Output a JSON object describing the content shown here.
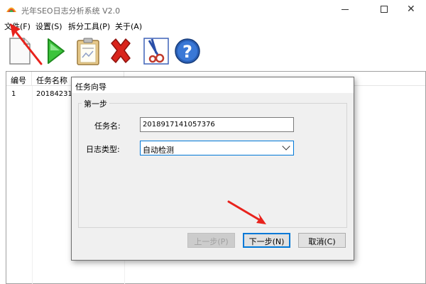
{
  "window": {
    "title": "光年SEO日志分析系统 V2.0",
    "minimize_glyph": "",
    "close_glyph": "✕"
  },
  "menu": [
    {
      "label": "文件(F)"
    },
    {
      "label": "设置(S)"
    },
    {
      "label": "拆分工具(P)"
    },
    {
      "label": "关于(A)"
    }
  ],
  "toolbar": {
    "tools": [
      {
        "icon": "new-document-icon"
      },
      {
        "icon": "play-icon"
      },
      {
        "icon": "clipboard-report-icon"
      },
      {
        "icon": "delete-x-icon"
      },
      {
        "icon": "split-scissors-icon"
      },
      {
        "icon": "help-icon"
      }
    ]
  },
  "list": {
    "columns": [
      "编号",
      "任务名称"
    ],
    "rows": [
      {
        "id": "1",
        "name": "2018423151"
      }
    ]
  },
  "dialog": {
    "title": "任务向导",
    "group_label": "第一步",
    "task_name_label": "任务名:",
    "task_name_value": "20189171410573​76",
    "log_type_label": "日志类型:",
    "log_type_value": "自动检测",
    "prev_button": "上一步(P)",
    "next_button": "下一步(N)",
    "cancel_button": "取消(C)"
  },
  "colors": {
    "annotation_arrow": "#e8221c",
    "focus_blue": "#0078d7"
  }
}
